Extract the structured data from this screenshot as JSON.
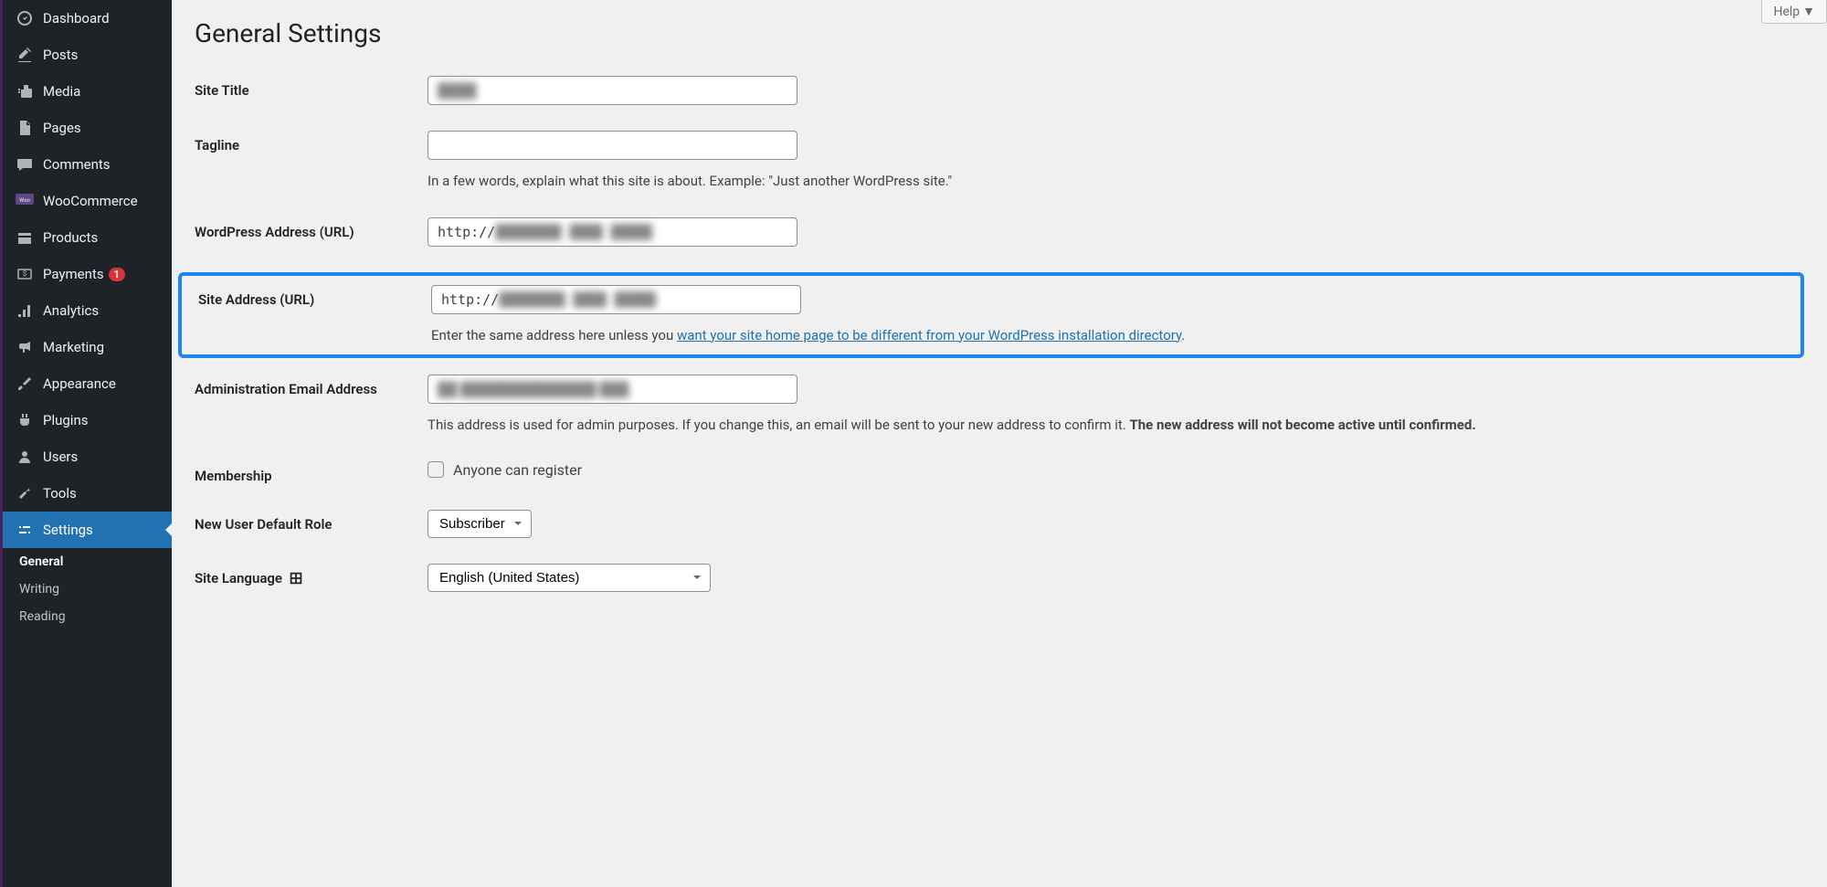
{
  "help": "Help",
  "page_title": "General Settings",
  "sidebar": {
    "items": [
      {
        "label": "Dashboard"
      },
      {
        "label": "Posts"
      },
      {
        "label": "Media"
      },
      {
        "label": "Pages"
      },
      {
        "label": "Comments"
      },
      {
        "label": "WooCommerce"
      },
      {
        "label": "Products"
      },
      {
        "label": "Payments",
        "badge": "1"
      },
      {
        "label": "Analytics"
      },
      {
        "label": "Marketing"
      },
      {
        "label": "Appearance"
      },
      {
        "label": "Plugins"
      },
      {
        "label": "Users"
      },
      {
        "label": "Tools"
      },
      {
        "label": "Settings"
      }
    ],
    "submenu": [
      {
        "label": "General"
      },
      {
        "label": "Writing"
      },
      {
        "label": "Reading"
      }
    ]
  },
  "form": {
    "site_title": {
      "label": "Site Title",
      "value": "████"
    },
    "tagline": {
      "label": "Tagline",
      "value": "",
      "description": "In a few words, explain what this site is about. Example: \"Just another WordPress site.\""
    },
    "wp_address": {
      "label": "WordPress Address (URL)",
      "value_prefix": "http://",
      "value_blur": "████████ ████ █████"
    },
    "site_address": {
      "label": "Site Address (URL)",
      "value_prefix": "http://",
      "value_blur": "████████ ████ █████",
      "desc_prefix": "Enter the same address here unless you ",
      "desc_link": "want your site home page to be different from your WordPress installation directory",
      "desc_suffix": "."
    },
    "admin_email": {
      "label": "Administration Email Address",
      "value_blur": "██ ██████████████ ███",
      "desc_prefix": "This address is used for admin purposes. If you change this, an email will be sent to your new address to confirm it. ",
      "desc_bold": "The new address will not become active until confirmed."
    },
    "membership": {
      "label": "Membership",
      "checkbox_label": "Anyone can register"
    },
    "default_role": {
      "label": "New User Default Role",
      "value": "Subscriber"
    },
    "site_language": {
      "label": "Site Language",
      "value": "English (United States)"
    }
  }
}
